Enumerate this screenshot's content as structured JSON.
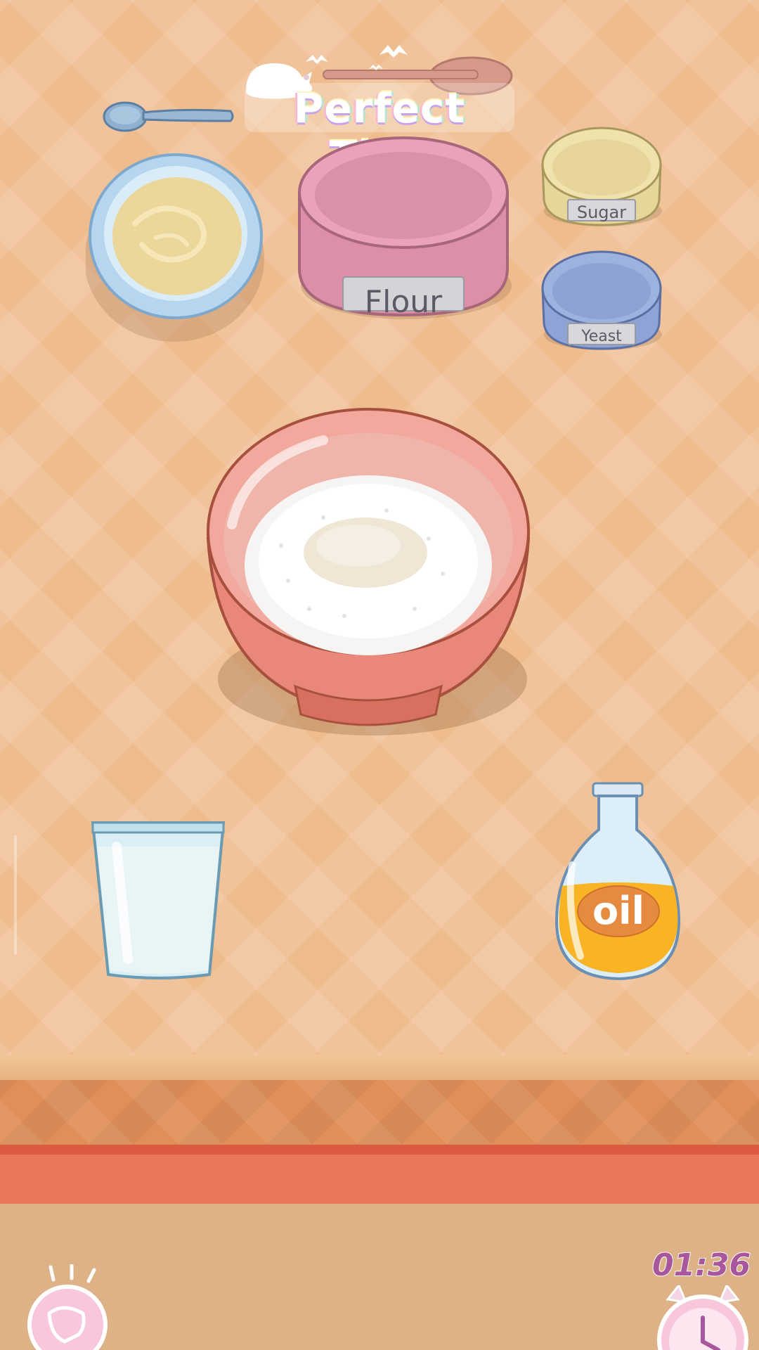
{
  "title": "Perfect Tidy",
  "containers": {
    "flour_label": "Flour",
    "sugar_label": "Sugar",
    "yeast_label": "Yeast",
    "oil_label": "oil"
  },
  "timer": "01:36",
  "icons": {
    "hint": "lightbulb-hint-icon",
    "timer": "alarm-clock-icon"
  },
  "colors": {
    "background": "#efbc8e",
    "counter": "#e08f58",
    "stripe": "#dc5a3f",
    "timer_text": "#a8579c"
  }
}
